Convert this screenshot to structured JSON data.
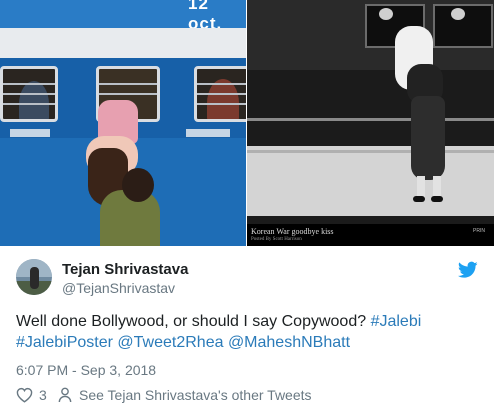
{
  "media": {
    "left_image": {
      "date_text": "12 oct."
    },
    "right_image": {
      "caption": "Korean War goodbye kiss",
      "caption_sub": "Posted By Scott Harrison",
      "corner_mark": "PRIN"
    }
  },
  "tweet": {
    "author": {
      "display_name": "Tejan Shrivastava",
      "handle": "@TejanShrivastav"
    },
    "text": {
      "plain": "Well done Bollywood, or should I say Copywood?",
      "hashtags": [
        "#Jalebi",
        "#JalebiPoster"
      ],
      "mentions": [
        "@Tweet2Rhea",
        "@MaheshNBhatt"
      ]
    },
    "timestamp": "6:07 PM - Sep 3, 2018",
    "likes": "3",
    "others_label": "See Tejan Shrivastava's other Tweets"
  },
  "colors": {
    "link": "#2b7bb9",
    "muted": "#697882",
    "text": "#1c2022",
    "twitter_blue": "#1da1f2"
  },
  "icons": {
    "brand": "twitter-bird-icon",
    "like": "heart-icon",
    "profile": "person-icon"
  }
}
